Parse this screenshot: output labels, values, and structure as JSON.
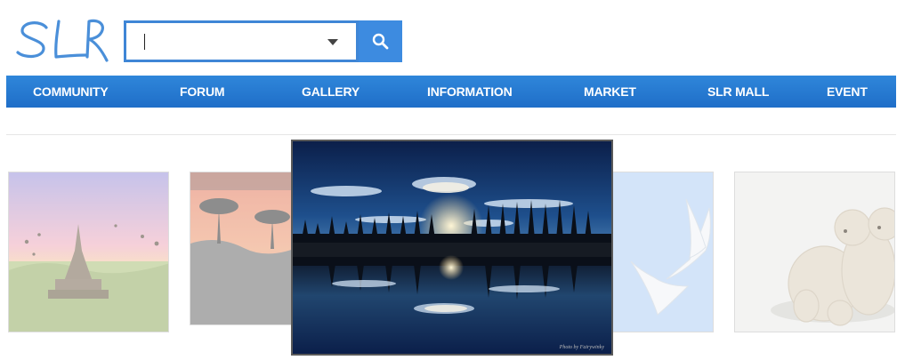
{
  "logo": {
    "text": "SLR"
  },
  "search": {
    "value": "",
    "placeholder": ""
  },
  "nav": {
    "items": [
      {
        "label": "COMMUNITY"
      },
      {
        "label": "FORUM"
      },
      {
        "label": "GALLERY"
      },
      {
        "label": "INFORMATION"
      },
      {
        "label": "MARKET"
      },
      {
        "label": "SLR MALL"
      },
      {
        "label": "EVENT"
      }
    ]
  },
  "gallery": {
    "featured_credit": "Photo by Fairywinky",
    "thumbnails": [
      {
        "subject": "temple-at-sunrise-with-balloons"
      },
      {
        "subject": "trees-at-sunset"
      },
      {
        "subject": "tree-line-reflection-sunset"
      },
      {
        "subject": "white-birds-flying"
      },
      {
        "subject": "polar-bear-cubs"
      }
    ]
  },
  "colors": {
    "accent": "#2f86da",
    "nav_bottom": "#1f6ec8",
    "search_border": "#3f86d6"
  },
  "icons": {
    "search": "search-icon",
    "dropdown": "chevron-down-icon"
  }
}
